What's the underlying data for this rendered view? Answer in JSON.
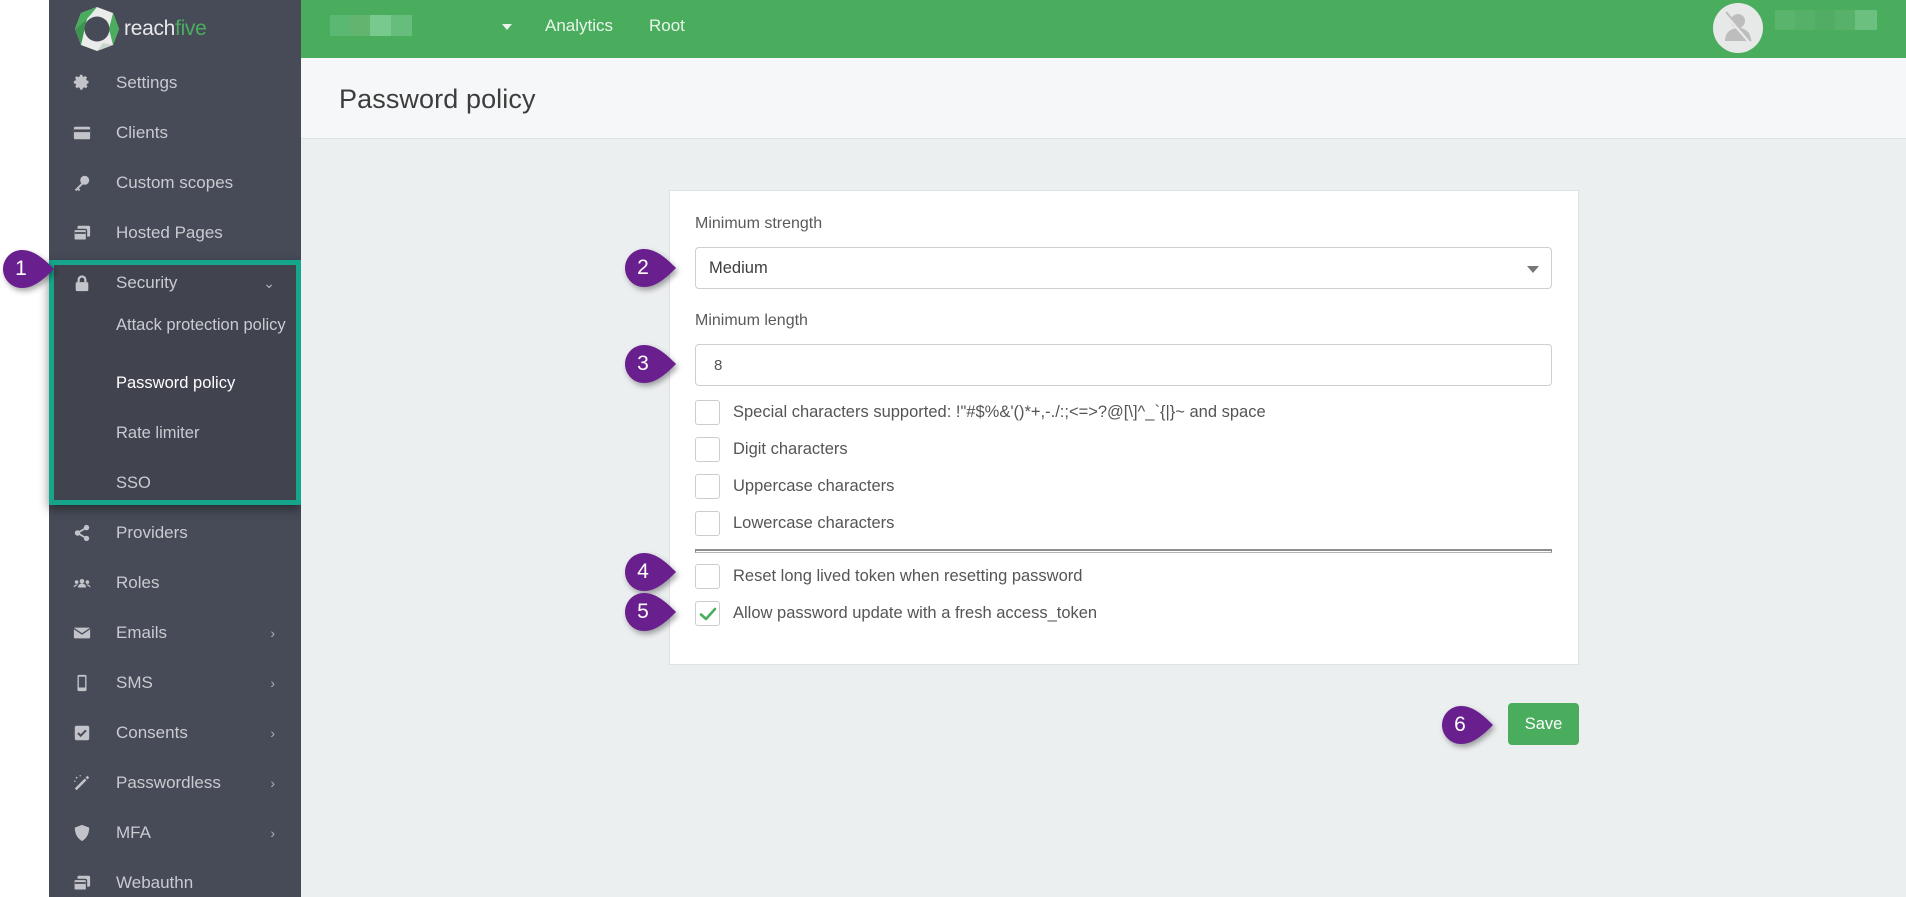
{
  "app": {
    "brand_part1": "reach",
    "brand_part2": "five",
    "brand_color": "#4aad5e",
    "accent_highlight": "#14a58b",
    "callout_color": "#6a1f8f"
  },
  "topbar": {
    "project_selector": "(redacted)",
    "links": [
      "Analytics",
      "Root"
    ],
    "user_name": "(redacted)",
    "avatar_icon": "user-slash-icon"
  },
  "sidebar": {
    "items": [
      {
        "label": "Settings",
        "icon": "gear-icon"
      },
      {
        "label": "Clients",
        "icon": "credit-card-icon"
      },
      {
        "label": "Custom scopes",
        "icon": "key-icon"
      },
      {
        "label": "Hosted Pages",
        "icon": "window-restore-icon"
      },
      {
        "label": "Security",
        "icon": "lock-icon",
        "expanded": true
      },
      {
        "label": "Providers",
        "icon": "share-icon"
      },
      {
        "label": "Roles",
        "icon": "users-icon"
      },
      {
        "label": "Emails",
        "icon": "envelope-icon",
        "has_children": true
      },
      {
        "label": "SMS",
        "icon": "mobile-icon",
        "has_children": true
      },
      {
        "label": "Consents",
        "icon": "check-square-icon",
        "has_children": true
      },
      {
        "label": "Passwordless",
        "icon": "magic-wand-icon",
        "has_children": true
      },
      {
        "label": "MFA",
        "icon": "shield-icon",
        "has_children": true
      },
      {
        "label": "Webauthn",
        "icon": "window-restore-icon"
      }
    ],
    "security_children": [
      {
        "label": "Attack protection policy",
        "active": false
      },
      {
        "label": "Password policy",
        "active": true
      },
      {
        "label": "Rate limiter",
        "active": false
      },
      {
        "label": "SSO",
        "active": false
      }
    ]
  },
  "page": {
    "title": "Password policy"
  },
  "form": {
    "min_strength_label": "Minimum strength",
    "min_strength_value": "Medium",
    "min_length_label": "Minimum length",
    "min_length_value": "8",
    "checkboxes": [
      {
        "label": "Special characters supported: !\"#$%&'()*+,-./:;<=>?@[\\]^_`{|}~ and space",
        "checked": false
      },
      {
        "label": "Digit characters",
        "checked": false
      },
      {
        "label": "Uppercase characters",
        "checked": false
      },
      {
        "label": "Lowercase characters",
        "checked": false
      }
    ],
    "token_options": [
      {
        "label": "Reset long lived token when resetting password",
        "checked": false
      },
      {
        "label": "Allow password update with a fresh access_token",
        "checked": true
      }
    ],
    "save_label": "Save"
  },
  "callouts": [
    "1",
    "2",
    "3",
    "4",
    "5",
    "6"
  ]
}
